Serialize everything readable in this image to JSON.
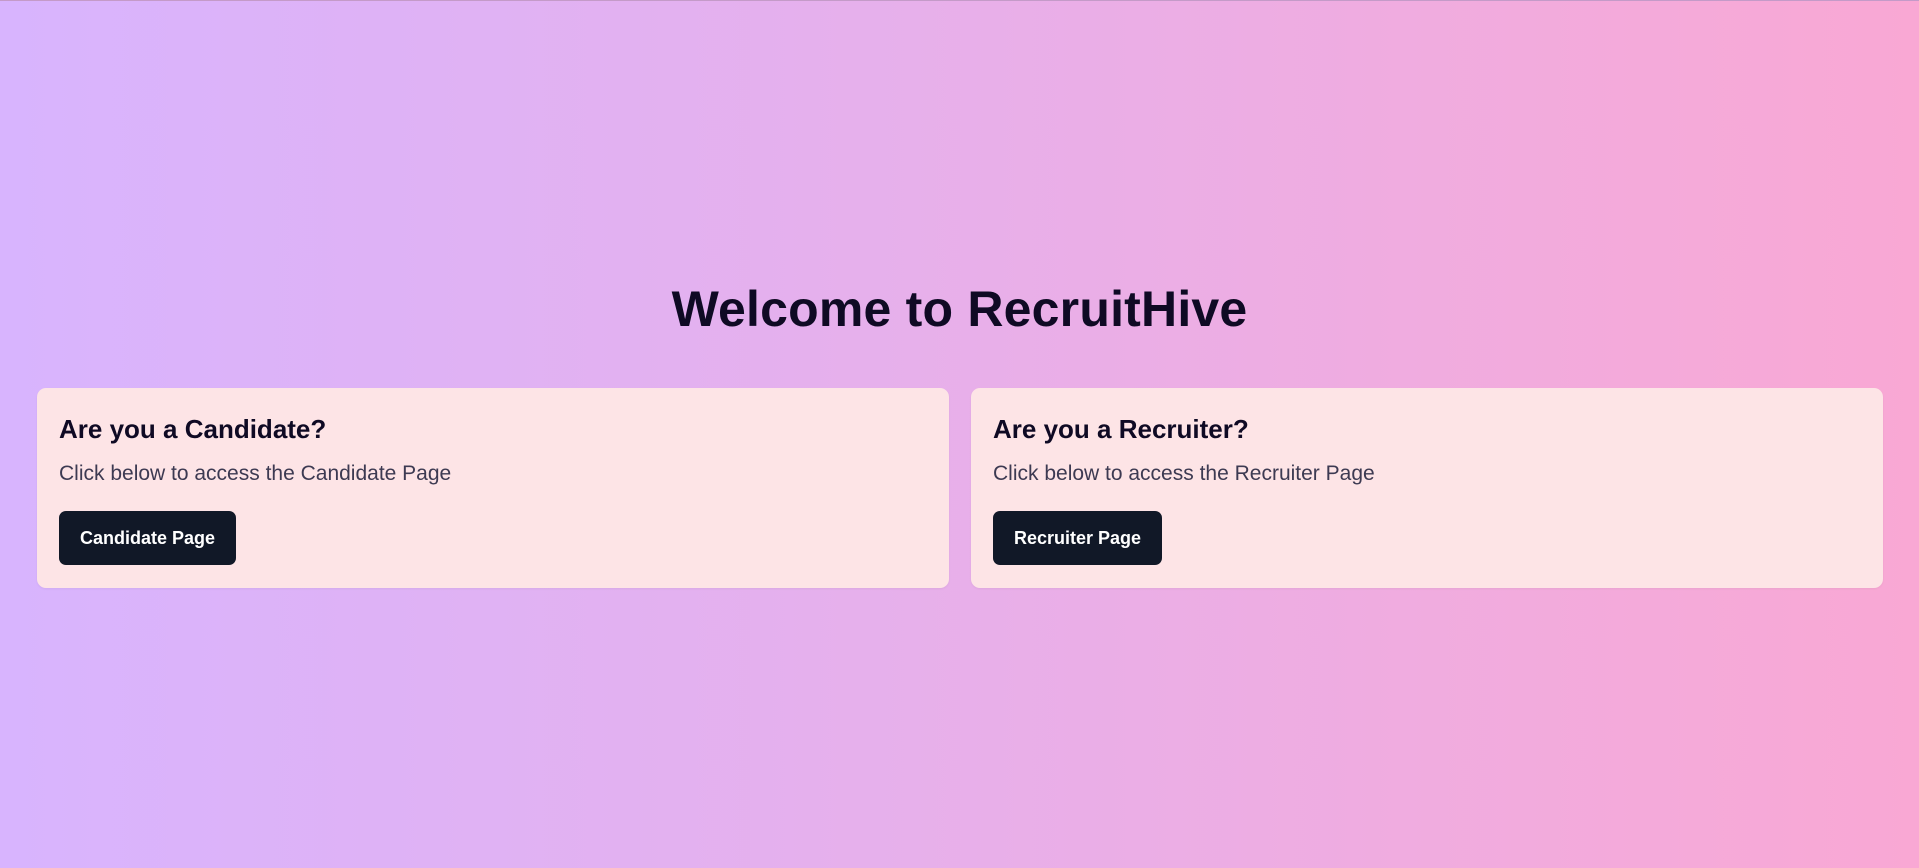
{
  "hero": {
    "title": "Welcome to RecruitHive"
  },
  "cards": [
    {
      "heading": "Are you a Candidate?",
      "description": "Click below to access the Candidate Page",
      "button_label": "Candidate Page"
    },
    {
      "heading": "Are you a Recruiter?",
      "description": "Click below to access the Recruiter Page",
      "button_label": "Recruiter Page"
    }
  ],
  "colors": {
    "gradient_start": "#d8b4fe",
    "gradient_end": "#f9a8d4",
    "card_background": "#fde4e6",
    "button_background": "#111827",
    "heading_text": "#0f0a24"
  }
}
